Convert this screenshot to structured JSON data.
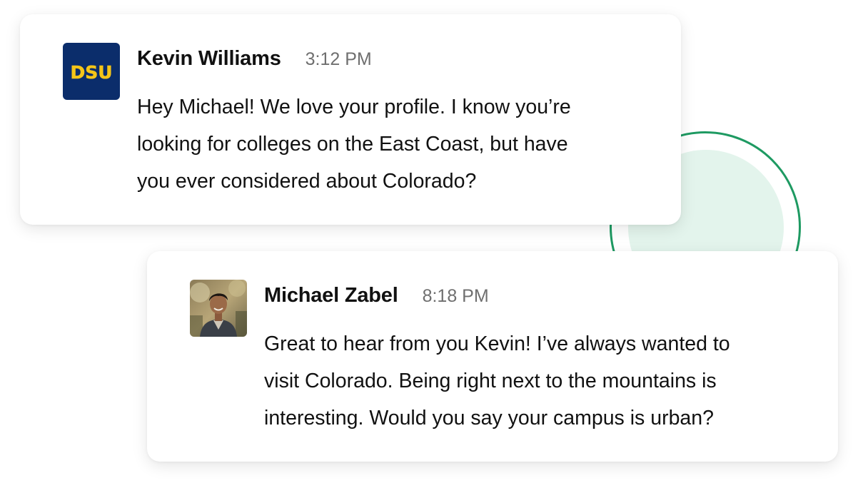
{
  "colors": {
    "accent_green": "#1e9a62",
    "accent_green_light": "#e3f4ec",
    "dsu_navy": "#0b2d6b",
    "dsu_gold": "#f5c518"
  },
  "messages": [
    {
      "sender": "Kevin Williams",
      "time": "3:12 PM",
      "avatar": {
        "type": "logo",
        "logo_text": "DSU"
      },
      "lines": [
        "Hey Michael! We love your profile. I know you’re",
        "looking for colleges on the East Coast, but have",
        "you ever considered about Colorado?"
      ]
    },
    {
      "sender": "Michael Zabel",
      "time": "8:18 PM",
      "avatar": {
        "type": "photo"
      },
      "lines": [
        "Great to hear from you Kevin! I’ve always wanted to",
        "visit Colorado. Being right next to the mountains is",
        "interesting. Would you say your campus is urban?"
      ]
    }
  ]
}
